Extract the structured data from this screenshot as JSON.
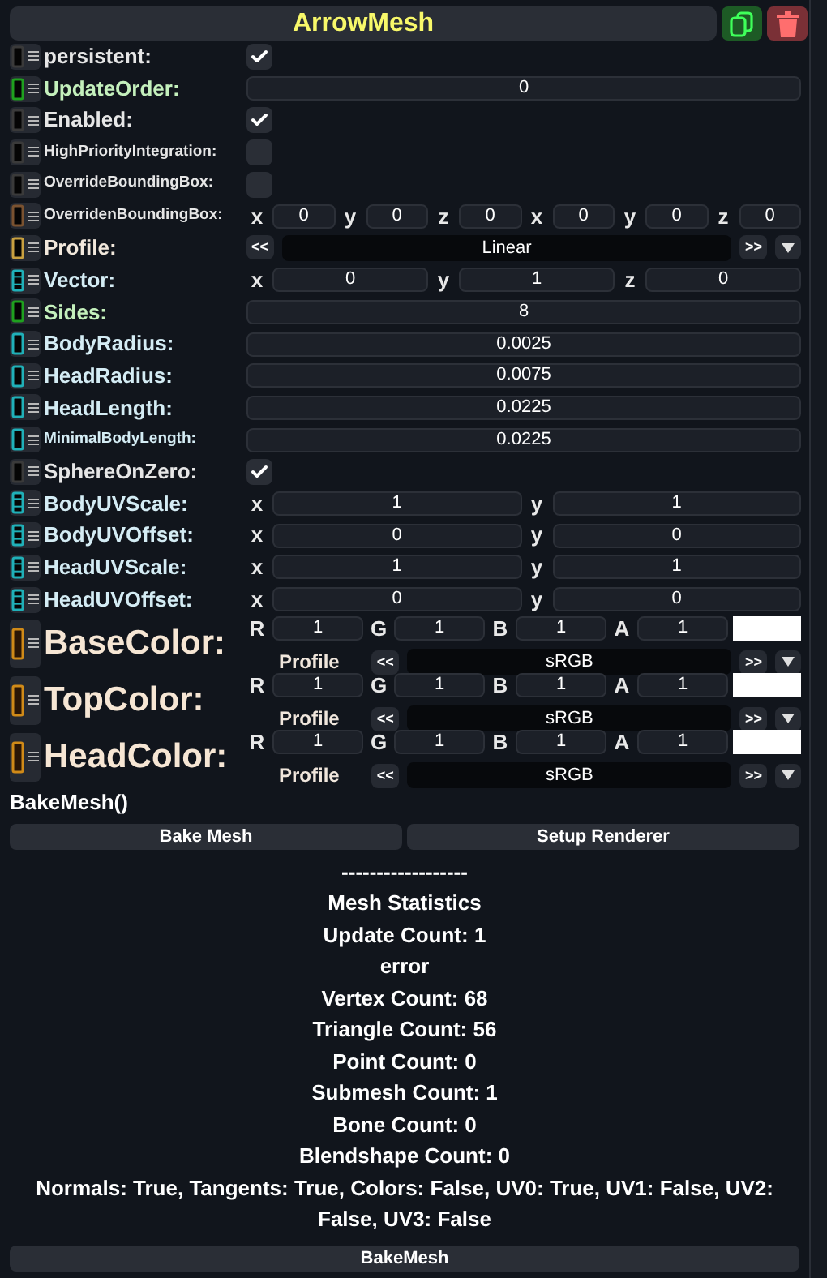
{
  "header": {
    "title": "ArrowMesh"
  },
  "fields": [
    {
      "label": "persistent:",
      "kind": "bool",
      "color": "#3a3a3a",
      "checked": true
    },
    {
      "label": "UpdateOrder:",
      "kind": "int",
      "color": "#1fa01f",
      "value": "0"
    },
    {
      "label": "Enabled:",
      "kind": "bool",
      "color": "#3a3a3a",
      "checked": true
    },
    {
      "label": "HighPriorityIntegration:",
      "kind": "bool",
      "color": "#3a3a3a",
      "checked": false
    },
    {
      "label": "OverrideBoundingBox:",
      "kind": "bool",
      "color": "#3a3a3a",
      "checked": false
    },
    {
      "label": "OverridenBoundingBox:",
      "kind": "bbox",
      "color": "#7a5230",
      "components": [
        {
          "axis": "x",
          "value": "0"
        },
        {
          "axis": "y",
          "value": "0"
        },
        {
          "axis": "z",
          "value": "0"
        },
        {
          "axis": "x",
          "value": "0"
        },
        {
          "axis": "y",
          "value": "0"
        },
        {
          "axis": "z",
          "value": "0"
        }
      ]
    },
    {
      "label": "Profile:",
      "kind": "enum",
      "color": "#c8a040",
      "value": "Linear",
      "prev": "<<",
      "next": ">>"
    },
    {
      "label": "Vector:",
      "kind": "vec3",
      "color": "#20b0b8",
      "components": [
        {
          "axis": "x",
          "value": "0"
        },
        {
          "axis": "y",
          "value": "1"
        },
        {
          "axis": "z",
          "value": "0"
        }
      ]
    },
    {
      "label": "Sides:",
      "kind": "int",
      "color": "#1fa01f",
      "value": "8"
    },
    {
      "label": "BodyRadius:",
      "kind": "float",
      "color": "#20b0b8",
      "value": "0.0025"
    },
    {
      "label": "HeadRadius:",
      "kind": "float",
      "color": "#20b0b8",
      "value": "0.0075"
    },
    {
      "label": "HeadLength:",
      "kind": "float",
      "color": "#20b0b8",
      "value": "0.0225"
    },
    {
      "label": "MinimalBodyLength:",
      "kind": "float",
      "color": "#20b0b8",
      "value": "0.0225"
    },
    {
      "label": "SphereOnZero:",
      "kind": "bool",
      "color": "#3a3a3a",
      "checked": true
    },
    {
      "label": "BodyUVScale:",
      "kind": "vec2",
      "color": "#20b0b8",
      "components": [
        {
          "axis": "x",
          "value": "1"
        },
        {
          "axis": "y",
          "value": "1"
        }
      ]
    },
    {
      "label": "BodyUVOffset:",
      "kind": "vec2",
      "color": "#20b0b8",
      "components": [
        {
          "axis": "x",
          "value": "0"
        },
        {
          "axis": "y",
          "value": "0"
        }
      ]
    },
    {
      "label": "HeadUVScale:",
      "kind": "vec2",
      "color": "#20b0b8",
      "components": [
        {
          "axis": "x",
          "value": "1"
        },
        {
          "axis": "y",
          "value": "1"
        }
      ]
    },
    {
      "label": "HeadUVOffset:",
      "kind": "vec2",
      "color": "#20b0b8",
      "components": [
        {
          "axis": "x",
          "value": "0"
        },
        {
          "axis": "y",
          "value": "0"
        }
      ]
    }
  ],
  "colors": [
    {
      "label": "BaseColor:",
      "channels": [
        {
          "name": "R",
          "value": "1"
        },
        {
          "name": "G",
          "value": "1"
        },
        {
          "name": "B",
          "value": "1"
        },
        {
          "name": "A",
          "value": "1"
        }
      ],
      "color": "#ffffff",
      "profile_label": "Profile",
      "profile": "sRGB",
      "prev": "<<",
      "next": ">>"
    },
    {
      "label": "TopColor:",
      "channels": [
        {
          "name": "R",
          "value": "1"
        },
        {
          "name": "G",
          "value": "1"
        },
        {
          "name": "B",
          "value": "1"
        },
        {
          "name": "A",
          "value": "1"
        }
      ],
      "color": "#ffffff",
      "profile_label": "Profile",
      "profile": "sRGB",
      "prev": "<<",
      "next": ">>"
    },
    {
      "label": "HeadColor:",
      "channels": [
        {
          "name": "R",
          "value": "1"
        },
        {
          "name": "G",
          "value": "1"
        },
        {
          "name": "B",
          "value": "1"
        },
        {
          "name": "A",
          "value": "1"
        }
      ],
      "color": "#ffffff",
      "profile_label": "Profile",
      "profile": "sRGB",
      "prev": "<<",
      "next": ">>"
    }
  ],
  "method": {
    "label": "BakeMesh()",
    "buttons": [
      "Bake Mesh",
      "Setup Renderer"
    ]
  },
  "stats": [
    "------------------",
    "Mesh Statistics",
    "Update Count: 1",
    "error",
    "Vertex Count: 68",
    "Triangle Count: 56",
    "Point Count: 0",
    "Submesh Count: 1",
    "Bone Count: 0",
    "Blendshape Count: 0",
    "Normals: True, Tangents: True, Colors: False, UV0: True, UV1: False, UV2: False, UV3: False"
  ],
  "footer_button": "BakeMesh"
}
